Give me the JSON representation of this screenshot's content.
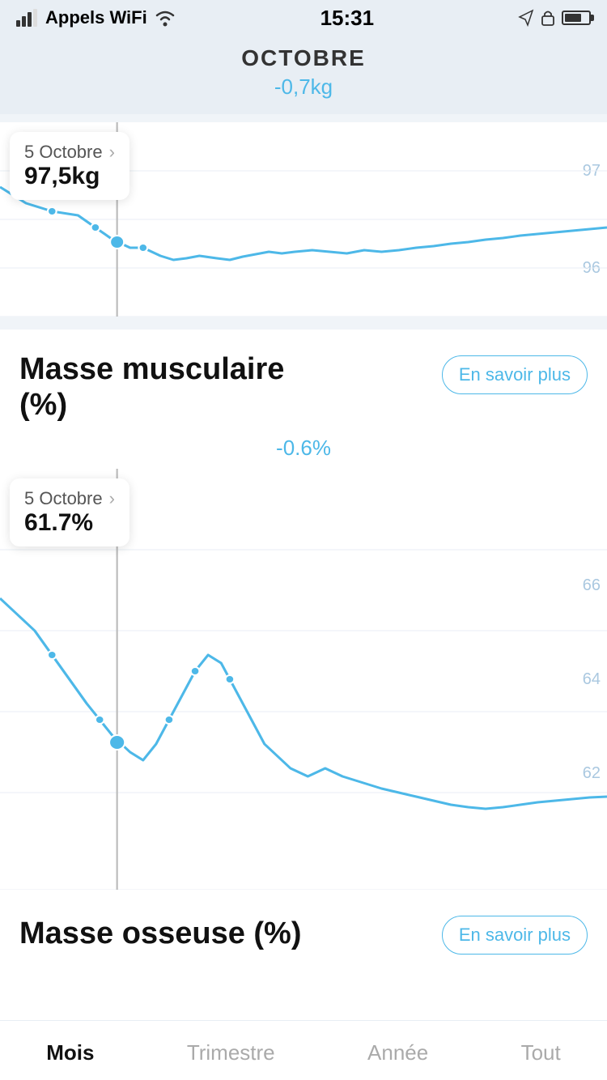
{
  "statusBar": {
    "carrier": "Appels WiFi",
    "time": "15:31",
    "wifi": true,
    "battery": 70
  },
  "header": {
    "title": "OCTOBRE",
    "subtitle": "-0,7kg"
  },
  "weightSection": {
    "tooltip": {
      "date": "5 Octobre",
      "value": "97,5kg",
      "arrowLabel": "›"
    },
    "yLabels": [
      "97",
      "96"
    ],
    "chartLine": "weight"
  },
  "muscleSection": {
    "title": "Masse musculaire\n(%)",
    "learnMoreLabel": "En savoir plus",
    "change": "-0.6%",
    "tooltip": {
      "date": "5 Octobre",
      "value": "61.7%",
      "arrowLabel": "›"
    },
    "yLabels": [
      "66",
      "64",
      "62"
    ],
    "chartLine": "muscle"
  },
  "boneSection": {
    "title": "Masse osseuse (%)",
    "learnMoreLabel": "En savoir plus"
  },
  "tabs": [
    {
      "label": "Mois",
      "active": true
    },
    {
      "label": "Trimestre",
      "active": false
    },
    {
      "label": "Année",
      "active": false
    },
    {
      "label": "Tout",
      "active": false
    }
  ]
}
